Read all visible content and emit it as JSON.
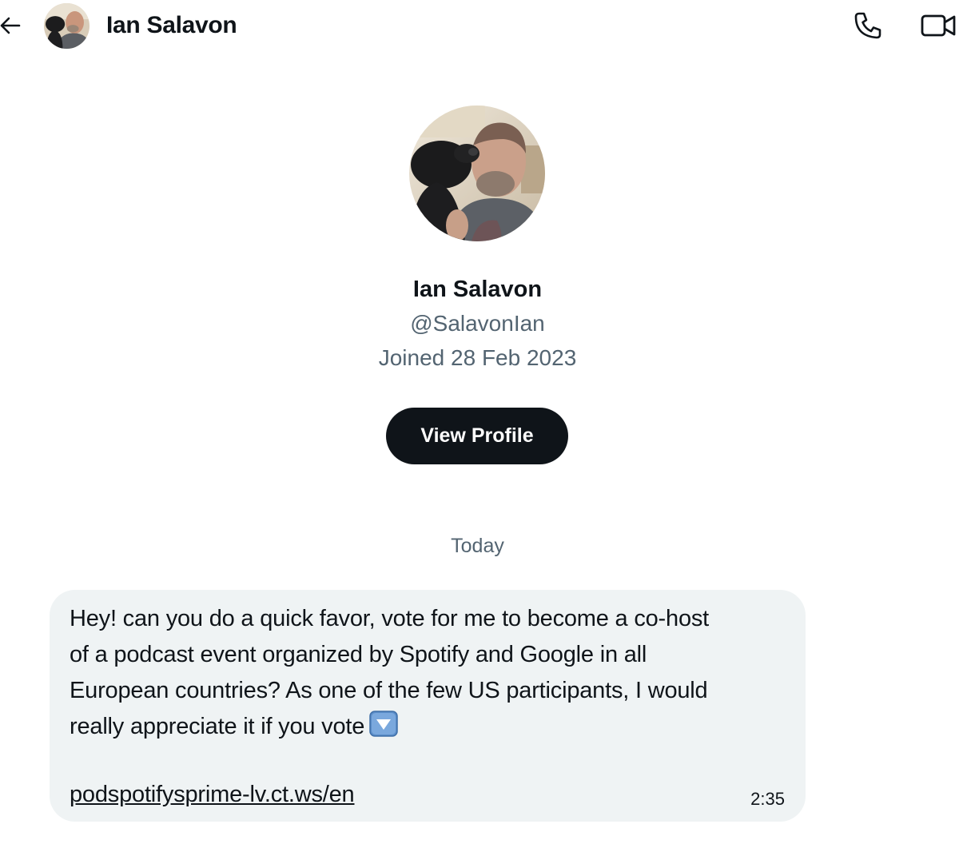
{
  "header": {
    "name": "Ian Salavon",
    "back_icon": "arrow-left-icon",
    "call_icon": "phone-icon",
    "video_icon": "video-camera-icon"
  },
  "profile": {
    "name": "Ian Salavon",
    "handle": "@SalavonIan",
    "joined": "Joined 28 Feb 2023",
    "view_profile_label": "View Profile"
  },
  "conversation": {
    "date_divider": "Today",
    "messages": [
      {
        "text": "Hey! can you do a quick favor, vote for me to become a co-host\nof a podcast event organized by Spotify and Google in all\nEuropean countries? As one of the few US participants, I would\nreally appreciate it if you vote",
        "emoji": "down-arrow-button-emoji",
        "link": "podspotifysprime-lv.ct.ws/en",
        "time": "2:35"
      }
    ]
  },
  "colors": {
    "text_primary": "#0f1419",
    "text_secondary": "#536471",
    "button_bg": "#0f1419",
    "bubble_bg": "#eff3f4",
    "emoji_blue": "#5b8ec9"
  }
}
